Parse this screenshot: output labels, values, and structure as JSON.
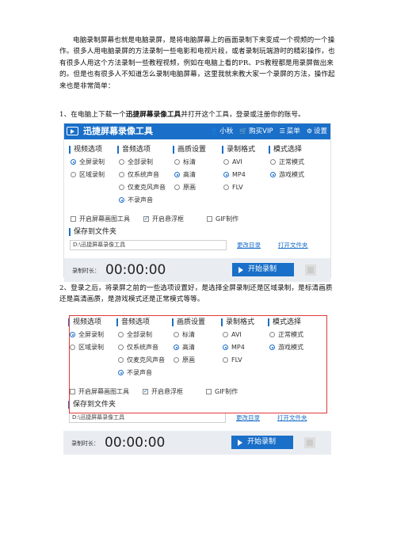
{
  "article": {
    "intro": "电脑录制屏幕也就是电脑录屏，是将电脑屏幕上的画面录制下来变成一个视频的一个操作。很多人用电脑录屏的方法录制一些电影和电视片段，或者录制玩端游时的精彩操作，也有很多人用这个方法录制一些教程视频，例如在电脑上看的PR、PS教程都是用录屏做出来的。但是也有很多人不知道怎么录制电脑屏幕，这里我就来教大家一个录屏的方法，操作起来也是非常简单：",
    "step1_prefix": "1、在电脑上下载一个",
    "step1_bold": "迅捷屏幕录像工具",
    "step1_suffix": "并打开这个工具，登录或注册你的账号。",
    "step2": "2、登录之后，将录屏之前的一些选项设置好，是选择全屏录制还是区域录制，是标清画质还是高清画质，是游戏模式还是正常模式等等。"
  },
  "app": {
    "title": "迅捷屏幕录像工具",
    "user": "小秋",
    "buy_vip": "购买VIP",
    "menu": "菜单",
    "settings": "设置",
    "columns": [
      {
        "head": "视频选项",
        "options": [
          {
            "label": "全屏录制",
            "checked": true
          },
          {
            "label": "区域录制",
            "checked": false
          }
        ]
      },
      {
        "head": "音频选项",
        "options": [
          {
            "label": "全部录制",
            "checked": false
          },
          {
            "label": "仅系统声音",
            "checked": false
          },
          {
            "label": "仅麦克风声音",
            "checked": false
          },
          {
            "label": "不录声音",
            "checked": true
          }
        ]
      },
      {
        "head": "画质设置",
        "options": [
          {
            "label": "标清",
            "checked": false
          },
          {
            "label": "高清",
            "checked": true
          },
          {
            "label": "原画",
            "checked": false
          }
        ]
      },
      {
        "head": "录制格式",
        "options": [
          {
            "label": "AVI",
            "checked": false
          },
          {
            "label": "MP4",
            "checked": true
          },
          {
            "label": "FLV",
            "checked": false
          }
        ]
      },
      {
        "head": "模式选择",
        "options": [
          {
            "label": "正常模式",
            "checked": false
          },
          {
            "label": "游戏模式",
            "checked": true
          }
        ]
      }
    ],
    "extras": [
      {
        "label": "开启屏幕画图工具",
        "checked": false
      },
      {
        "label": "开启悬浮框",
        "checked": true
      },
      {
        "label": "GIF制作",
        "checked": false
      }
    ],
    "save_head": "保存到文件夹",
    "save_path": "D:\\迅捷屏幕录像工具",
    "change_dir": "更改目录",
    "open_folder": "打开文件夹",
    "rec_label": "录制时长：",
    "timer": "00:00:00",
    "start": "开始录制"
  },
  "colors": {
    "accent": "#1a6fc8",
    "highlight_frame": "#e03a3a"
  }
}
